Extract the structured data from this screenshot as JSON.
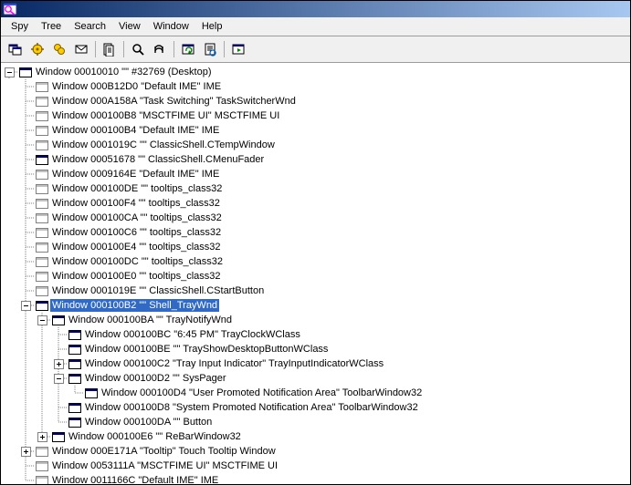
{
  "menu": {
    "spy": "Spy",
    "tree": "Tree",
    "search": "Search",
    "view": "View",
    "window": "Window",
    "help": "Help"
  },
  "tree": [
    {
      "depth": 0,
      "expander": "minus",
      "style": "visible",
      "selected": false,
      "text": "Window 00010010 \"\" #32769 (Desktop)"
    },
    {
      "depth": 1,
      "expander": "none",
      "style": "hidden",
      "selected": false,
      "text": "Window 000B12D0 \"Default IME\" IME"
    },
    {
      "depth": 1,
      "expander": "none",
      "style": "hidden",
      "selected": false,
      "text": "Window 000A158A \"Task Switching\" TaskSwitcherWnd"
    },
    {
      "depth": 1,
      "expander": "none",
      "style": "hidden",
      "selected": false,
      "text": "Window 000100B8 \"MSCTFIME UI\" MSCTFIME UI"
    },
    {
      "depth": 1,
      "expander": "none",
      "style": "hidden",
      "selected": false,
      "text": "Window 000100B4 \"Default IME\" IME"
    },
    {
      "depth": 1,
      "expander": "none",
      "style": "hidden",
      "selected": false,
      "text": "Window 0001019C \"\" ClassicShell.CTempWindow"
    },
    {
      "depth": 1,
      "expander": "none",
      "style": "visible",
      "selected": false,
      "text": "Window 00051678 \"\" ClassicShell.CMenuFader"
    },
    {
      "depth": 1,
      "expander": "none",
      "style": "hidden",
      "selected": false,
      "text": "Window 0009164E \"Default IME\" IME"
    },
    {
      "depth": 1,
      "expander": "none",
      "style": "hidden",
      "selected": false,
      "text": "Window 000100DE \"\" tooltips_class32"
    },
    {
      "depth": 1,
      "expander": "none",
      "style": "hidden",
      "selected": false,
      "text": "Window 000100F4 \"\" tooltips_class32"
    },
    {
      "depth": 1,
      "expander": "none",
      "style": "hidden",
      "selected": false,
      "text": "Window 000100CA \"\" tooltips_class32"
    },
    {
      "depth": 1,
      "expander": "none",
      "style": "hidden",
      "selected": false,
      "text": "Window 000100C6 \"\" tooltips_class32"
    },
    {
      "depth": 1,
      "expander": "none",
      "style": "hidden",
      "selected": false,
      "text": "Window 000100E4 \"\" tooltips_class32"
    },
    {
      "depth": 1,
      "expander": "none",
      "style": "hidden",
      "selected": false,
      "text": "Window 000100DC \"\" tooltips_class32"
    },
    {
      "depth": 1,
      "expander": "none",
      "style": "hidden",
      "selected": false,
      "text": "Window 000100E0 \"\" tooltips_class32"
    },
    {
      "depth": 1,
      "expander": "none",
      "style": "hidden",
      "selected": false,
      "text": "Window 0001019E \"\" ClassicShell.CStartButton"
    },
    {
      "depth": 1,
      "expander": "minus",
      "style": "visible",
      "selected": true,
      "text": "Window 000100B2 \"\" Shell_TrayWnd"
    },
    {
      "depth": 2,
      "expander": "minus",
      "style": "visible",
      "selected": false,
      "text": "Window 000100BA \"\" TrayNotifyWnd"
    },
    {
      "depth": 3,
      "expander": "none",
      "style": "visible",
      "selected": false,
      "text": "Window 000100BC \"6:45 PM\" TrayClockWClass"
    },
    {
      "depth": 3,
      "expander": "none",
      "style": "visible",
      "selected": false,
      "text": "Window 000100BE \"\" TrayShowDesktopButtonWClass"
    },
    {
      "depth": 3,
      "expander": "plus",
      "style": "visible",
      "selected": false,
      "text": "Window 000100C2 \"Tray Input Indicator\" TrayInputIndicatorWClass"
    },
    {
      "depth": 3,
      "expander": "minus",
      "style": "visible",
      "selected": false,
      "text": "Window 000100D2 \"\" SysPager"
    },
    {
      "depth": 4,
      "expander": "none",
      "style": "visible",
      "selected": false,
      "text": "Window 000100D4 \"User Promoted Notification Area\" ToolbarWindow32"
    },
    {
      "depth": 3,
      "expander": "none",
      "style": "visible",
      "selected": false,
      "text": "Window 000100D8 \"System Promoted Notification Area\" ToolbarWindow32"
    },
    {
      "depth": 3,
      "expander": "none",
      "style": "visible",
      "selected": false,
      "text": "Window 000100DA \"\" Button"
    },
    {
      "depth": 2,
      "expander": "plus",
      "style": "visible",
      "selected": false,
      "text": "Window 000100E6 \"\" ReBarWindow32"
    },
    {
      "depth": 1,
      "expander": "plus",
      "style": "hidden",
      "selected": false,
      "text": "Window 000E171A \"Tooltip\" Touch Tooltip Window"
    },
    {
      "depth": 1,
      "expander": "none",
      "style": "hidden",
      "selected": false,
      "text": "Window 0053111A \"MSCTFIME UI\" MSCTFIME UI"
    },
    {
      "depth": 1,
      "expander": "none",
      "style": "hidden",
      "selected": false,
      "text": "Window 0011166C \"Default IME\" IME"
    }
  ]
}
